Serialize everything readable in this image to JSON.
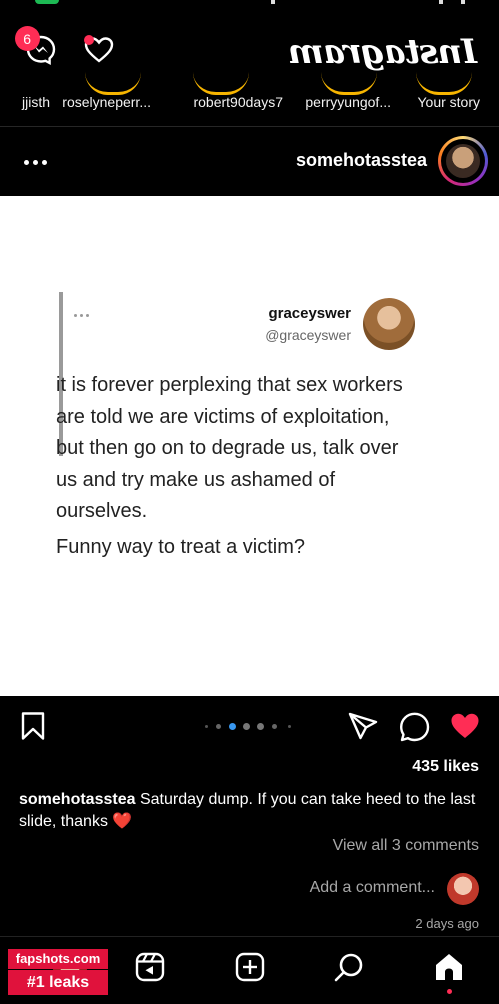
{
  "header": {
    "logo_text": "Instagram",
    "notification_count": "6"
  },
  "stories": [
    {
      "label": "Your story"
    },
    {
      "label": "perryyungof..."
    },
    {
      "label": "robert90days7"
    },
    {
      "label": "roselyneperr..."
    },
    {
      "label": "jjisth"
    }
  ],
  "post": {
    "username": "somehotassteа",
    "tweet": {
      "name": "graceyswer",
      "handle": "@graceyswer",
      "text": "it is forever perplexing that sex workers are told we are victims of exploitation, but then go on to degrade us, talk over us and try make us ashamed of ourselves.",
      "text2": "Funny way to treat a victim?"
    },
    "carousel": {
      "total": 6,
      "active_index": 1
    },
    "likes": "435 likes",
    "caption_user": "somehotasstea",
    "caption_text": "Saturday dump. If you can take heed to the last slide, thanks",
    "caption_emoji": "❤️",
    "view_comments": "View all 3 comments",
    "add_comment_placeholder": "Add a comment...",
    "time_ago": "2 days ago"
  },
  "colors": {
    "background": "#000000",
    "like_red": "#ff2d55",
    "story_ring": "#f7b500"
  },
  "watermark": {
    "line1": "fapshots.com",
    "line2": "#1 leaks"
  },
  "icons": [
    "messenger-icon",
    "heart-icon",
    "more-icon",
    "like-icon",
    "comment-icon",
    "share-icon",
    "save-icon",
    "home-icon",
    "search-icon",
    "create-icon",
    "reels-icon"
  ]
}
